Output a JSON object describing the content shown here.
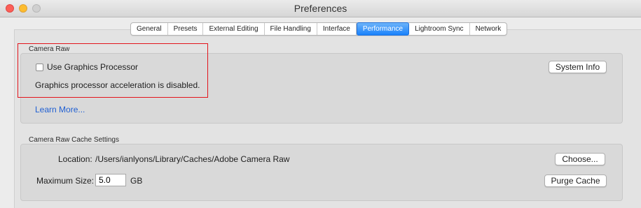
{
  "window": {
    "title": "Preferences"
  },
  "tabs": [
    {
      "label": "General"
    },
    {
      "label": "Presets"
    },
    {
      "label": "External Editing"
    },
    {
      "label": "File Handling"
    },
    {
      "label": "Interface"
    },
    {
      "label": "Performance",
      "active": true
    },
    {
      "label": "Lightroom Sync"
    },
    {
      "label": "Network"
    }
  ],
  "camera_raw": {
    "legend": "Camera Raw",
    "use_gpu_label": "Use Graphics Processor",
    "use_gpu_checked": false,
    "status_text": "Graphics processor acceleration is disabled.",
    "learn_more": "Learn More...",
    "system_info_button": "System Info"
  },
  "cache": {
    "legend": "Camera Raw Cache Settings",
    "location_label": "Location:",
    "location_value": "/Users/ianlyons/Library/Caches/Adobe Camera Raw",
    "choose_button": "Choose...",
    "max_size_label": "Maximum Size:",
    "max_size_value": "5.0",
    "max_size_unit": "GB",
    "purge_button": "Purge Cache"
  },
  "colors": {
    "active_tab": "#1a82fb",
    "link": "#1f5fd3",
    "highlight_box": "#e3141b"
  }
}
